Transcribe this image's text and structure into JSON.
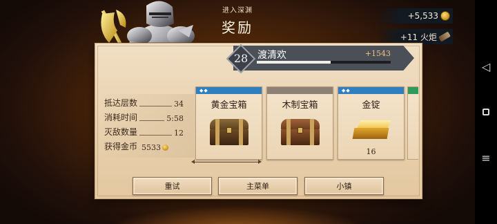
{
  "header": {
    "subtitle": "进入深渊",
    "title": "奖励"
  },
  "currencies": {
    "gold": "+5,533",
    "torch": "+11 火炬"
  },
  "player": {
    "level": "28",
    "name": "渡清欢",
    "xp_gain": "+1543",
    "xp_progress": 0.55
  },
  "stats": [
    {
      "label": "抵达层数",
      "value": "34"
    },
    {
      "label": "消耗时间",
      "value": "5:58"
    },
    {
      "label": "灭敌数量",
      "value": "12"
    },
    {
      "label": "获得金币",
      "value": "5533"
    }
  ],
  "rewards": [
    {
      "title": "黄金宝箱",
      "rarity": "blue",
      "gems": "◆◆",
      "qty": ""
    },
    {
      "title": "木制宝箱",
      "rarity": "gray",
      "gems": "",
      "qty": ""
    },
    {
      "title": "金锭",
      "rarity": "blue",
      "gems": "◆◆",
      "qty": "16"
    }
  ],
  "buttons": {
    "retry": "重试",
    "main_menu": "主菜单",
    "town": "小镇"
  },
  "colors": {
    "rarity_blue": "#2f7fc0",
    "rarity_gray": "#8d8176",
    "rarity_green": "#2e9b5c",
    "banner": "#4b4f58"
  },
  "icons": {
    "gold": "gold-coin-icon",
    "torch": "torch-icon",
    "back": "back-triangle-icon",
    "home": "home-square-icon",
    "menu": "menu-lines-icon"
  }
}
